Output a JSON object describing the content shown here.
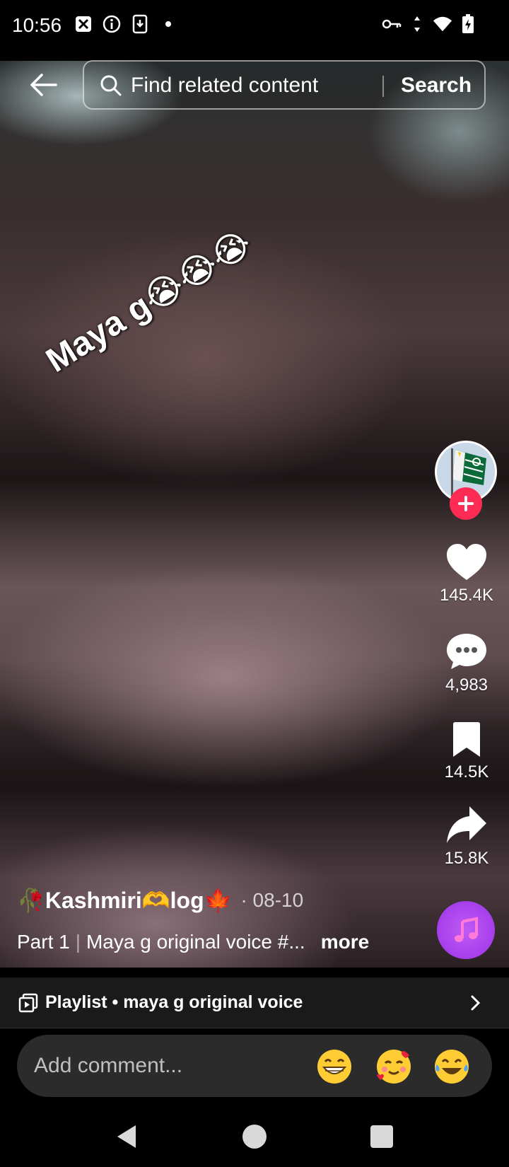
{
  "status_bar": {
    "time": "10:56"
  },
  "top_bar": {
    "search_placeholder": "Find related content",
    "search_button": "Search"
  },
  "video": {
    "overlay_text": "Maya g😭😭😭"
  },
  "actions": {
    "likes": "145.4K",
    "comments": "4,983",
    "bookmarks": "14.5K",
    "shares": "15.8K"
  },
  "author": {
    "name": "🥀Kashmiri🫶log🍁",
    "date": "· 08-10"
  },
  "caption": {
    "part": "Part 1",
    "text": "Maya g original voice #...",
    "more": "more"
  },
  "playlist": {
    "label": "Playlist • maya g original voice"
  },
  "comment": {
    "placeholder": "Add comment...",
    "emojis": [
      "😁",
      "🥰",
      "😂"
    ]
  },
  "colors": {
    "follow_red": "#fe2c55",
    "music_purple": "#a63cec"
  }
}
